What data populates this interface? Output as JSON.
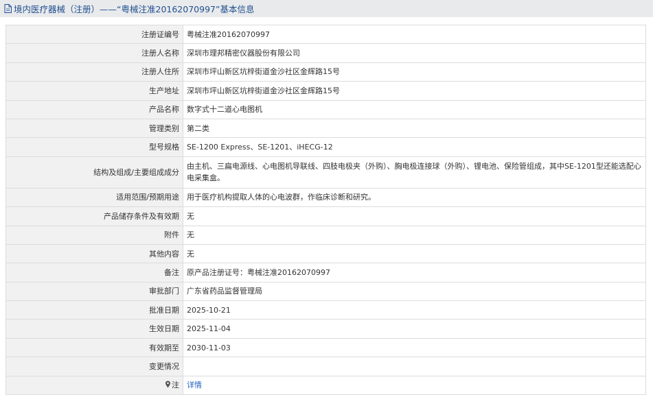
{
  "header": {
    "prefix": "境内医疗器械（注册）",
    "separator": " ——“粤械注准20162070997”基本信息"
  },
  "rows": [
    {
      "label": "注册证编号",
      "value": "粤械注准20162070997"
    },
    {
      "label": "注册人名称",
      "value": "深圳市理邦精密仪器股份有限公司"
    },
    {
      "label": "注册人住所",
      "value": "深圳市坪山新区坑梓街道金沙社区金辉路15号"
    },
    {
      "label": "生产地址",
      "value": "深圳市坪山新区坑梓街道金沙社区金辉路15号"
    },
    {
      "label": "产品名称",
      "value": "数字式十二道心电图机"
    },
    {
      "label": "管理类别",
      "value": "第二类"
    },
    {
      "label": "型号规格",
      "value": "SE-1200 Express、SE-1201、iHECG-12"
    },
    {
      "label": "结构及组成/主要组成成分",
      "value": "由主机、三扁电源线、心电图机导联线、四肢电极夹（外购）、胸电极连接球（外购）、锂电池、保险管组成，其中SE-1201型还能选配心电采集盒。"
    },
    {
      "label": "适用范围/预期用途",
      "value": "用于医疗机构提取人体的心电波群，作临床诊断和研究。"
    },
    {
      "label": "产品储存条件及有效期",
      "value": "无"
    },
    {
      "label": "附件",
      "value": "无"
    },
    {
      "label": "其他内容",
      "value": "无"
    },
    {
      "label": "备注",
      "value": "原产品注册证号：粤械注准20162070997"
    },
    {
      "label": "审批部门",
      "value": "广东省药品监督管理局"
    },
    {
      "label": "批准日期",
      "value": "2025-10-21"
    },
    {
      "label": "生效日期",
      "value": "2025-11-04"
    },
    {
      "label": "有效期至",
      "value": "2030-11-03"
    },
    {
      "label": "变更情况",
      "value": ""
    },
    {
      "label": "注",
      "value": "详情"
    }
  ]
}
